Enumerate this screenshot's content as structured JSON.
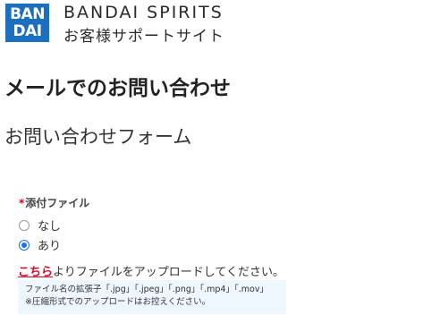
{
  "header": {
    "logo_line1": "BAN",
    "logo_line2": "DAI",
    "brand_name": "BANDAI SPIRITS",
    "brand_subtitle": "お客様サポートサイト"
  },
  "page": {
    "title": "メールでのお問い合わせ",
    "form_title": "お問い合わせフォーム"
  },
  "attachment": {
    "required_mark": "*",
    "label": "添付ファイル",
    "options": [
      {
        "label": "なし",
        "checked": false
      },
      {
        "label": "あり",
        "checked": true
      }
    ],
    "upload_link": "こちら",
    "upload_text": "よりファイルをアップロードしてください。",
    "note_line1": "ファイル名の拡張子「.jpg」「.jpeg」「.png」「.mp4」「.mov」",
    "note_line2": "※圧縮形式でのアップロードはお控えください。"
  },
  "colors": {
    "brand_blue": "#1b6fbd",
    "required_red": "#d0021b",
    "link_red": "#c8102e",
    "radio_selected": "#1a73e8",
    "note_bg": "#eef6ff"
  }
}
